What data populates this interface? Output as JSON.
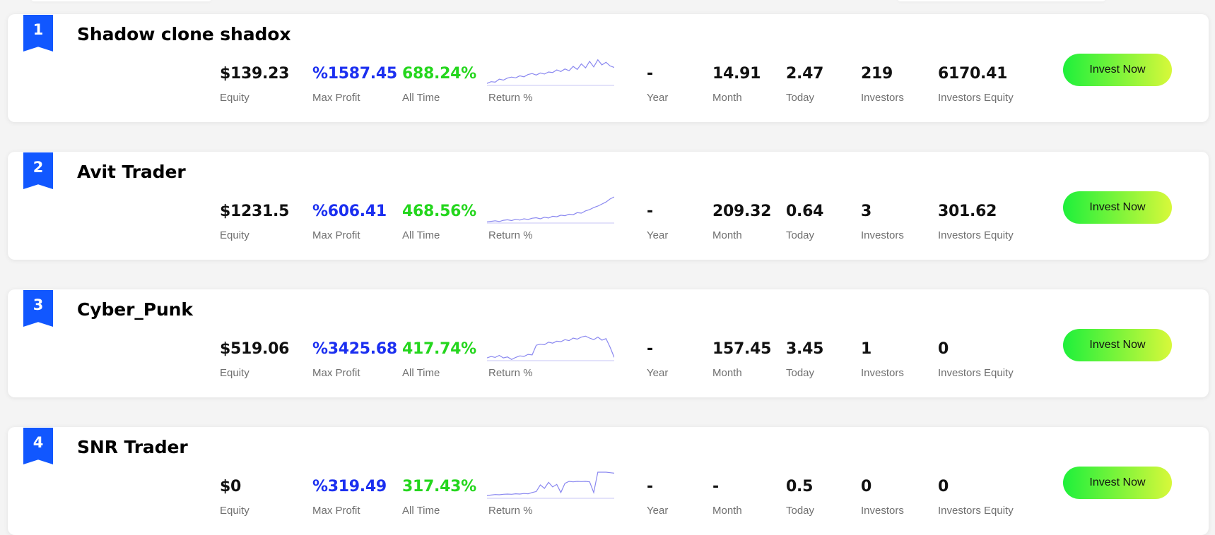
{
  "leaderboard": {
    "traders": [
      {
        "rank": "1",
        "name": "Shadow clone shadox",
        "equity": "$139.23",
        "max_profit": "%1587.45",
        "all_time": "688.24%",
        "year": "-",
        "month": "14.91",
        "today": "2.47",
        "investors": "219",
        "investors_equity": "6170.41",
        "sparkline": [
          0.05,
          0.12,
          0.1,
          0.22,
          0.18,
          0.26,
          0.3,
          0.27,
          0.35,
          0.31,
          0.4,
          0.44,
          0.38,
          0.46,
          0.42,
          0.5,
          0.48,
          0.58,
          0.52,
          0.62,
          0.55,
          0.72,
          0.6,
          0.82,
          0.66,
          0.92,
          0.7,
          0.98,
          0.78,
          0.88,
          0.74,
          0.68
        ]
      },
      {
        "rank": "2",
        "name": "Avit Trader",
        "equity": "$1231.5",
        "max_profit": "%606.41",
        "all_time": "468.56%",
        "year": "-",
        "month": "209.32",
        "today": "0.64",
        "investors": "3",
        "investors_equity": "301.62",
        "sparkline": [
          0.02,
          0.04,
          0.06,
          0.03,
          0.08,
          0.1,
          0.07,
          0.12,
          0.09,
          0.14,
          0.11,
          0.16,
          0.18,
          0.14,
          0.2,
          0.17,
          0.24,
          0.22,
          0.28,
          0.26,
          0.32,
          0.3,
          0.38,
          0.36,
          0.45,
          0.5,
          0.58,
          0.64,
          0.72,
          0.8,
          0.92,
          1.0
        ]
      },
      {
        "rank": "3",
        "name": "Cyber_Punk",
        "equity": "$519.06",
        "max_profit": "%3425.68",
        "all_time": "417.74%",
        "year": "-",
        "month": "157.45",
        "today": "3.45",
        "investors": "1",
        "investors_equity": "0",
        "sparkline": [
          0.08,
          0.14,
          0.1,
          0.18,
          0.08,
          0.12,
          0.02,
          0.1,
          0.16,
          0.14,
          0.22,
          0.2,
          0.58,
          0.62,
          0.6,
          0.7,
          0.66,
          0.74,
          0.72,
          0.8,
          0.76,
          0.86,
          0.82,
          0.9,
          0.94,
          0.86,
          0.8,
          0.9,
          0.78,
          0.84,
          0.5,
          0.1
        ]
      },
      {
        "rank": "4",
        "name": "SNR Trader",
        "equity": "$0",
        "max_profit": "%319.49",
        "all_time": "317.43%",
        "year": "-",
        "month": "-",
        "today": "0.5",
        "investors": "0",
        "investors_equity": "0",
        "sparkline": [
          0.08,
          0.1,
          0.12,
          0.11,
          0.13,
          0.14,
          0.13,
          0.15,
          0.14,
          0.16,
          0.15,
          0.2,
          0.24,
          0.5,
          0.36,
          0.6,
          0.42,
          0.52,
          0.2,
          0.56,
          0.64,
          0.62,
          0.64,
          0.63,
          0.64,
          0.62,
          0.2,
          1.0,
          1.0,
          1.0,
          0.98,
          0.96
        ]
      }
    ]
  },
  "labels": {
    "equity": "Equity",
    "max_profit": "Max Profit",
    "all_time": "All Time",
    "return_pct": "Return %",
    "year": "Year",
    "month": "Month",
    "today": "Today",
    "investors": "Investors",
    "investors_equity": "Investors Equity",
    "invest_button": "Invest Now"
  },
  "colors": {
    "rank_badge": "#1157ff",
    "max_profit": "#1b2ff0",
    "all_time": "#24d61d",
    "sparkline": "#8a88f0",
    "sparkline_baseline": "#c7c5f5",
    "button_gradient_start": "#1ef03b",
    "button_gradient_end": "#d8f83a"
  }
}
